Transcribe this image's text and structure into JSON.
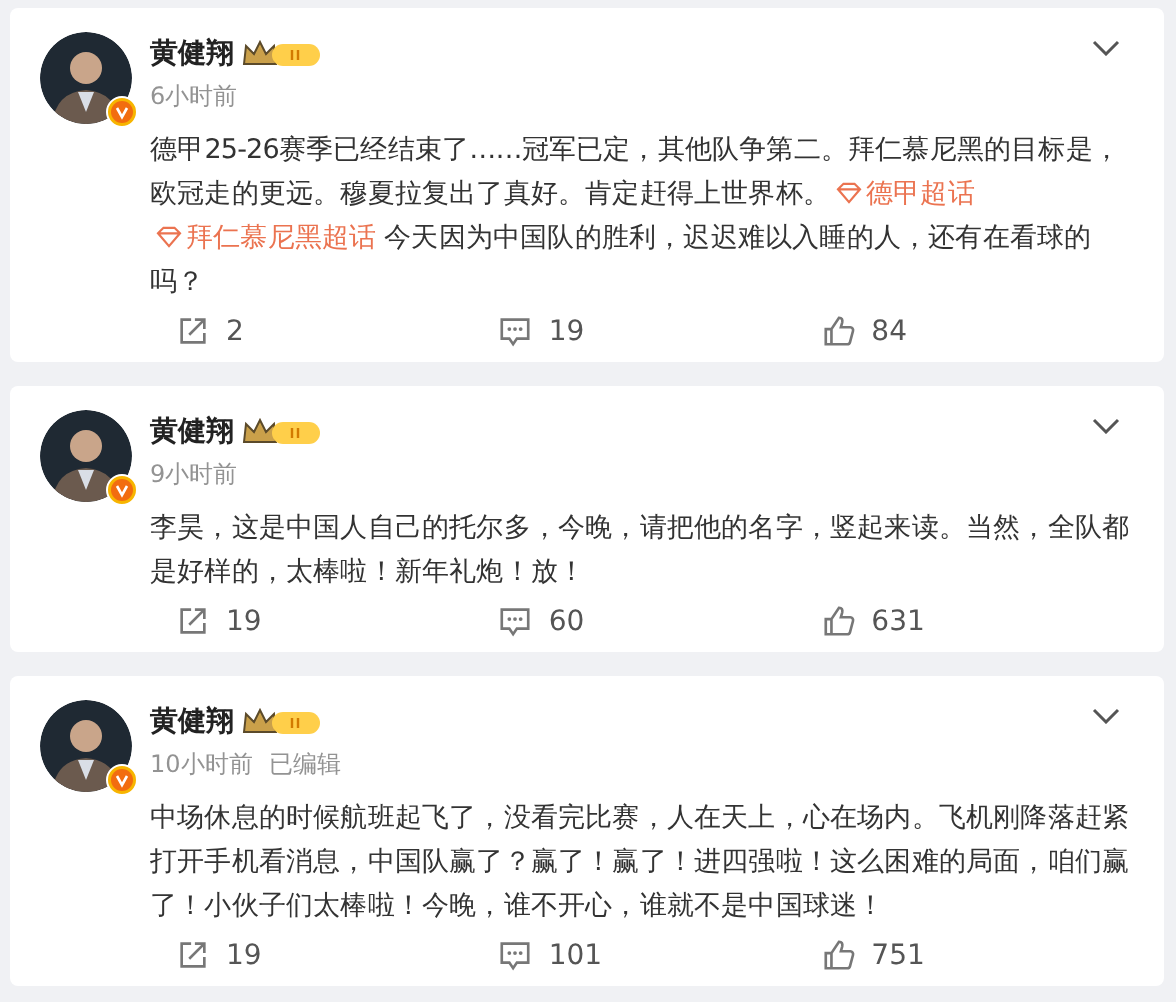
{
  "posts": [
    {
      "author": "黄健翔",
      "time": "6小时前",
      "content": [
        {
          "kind": "text",
          "text": "德甲25-26赛季已经结束了……冠军已定，其他队争第二。拜仁慕尼黑的目标是，欧冠走的更远。穆夏拉复出了真好。肯定赶得上世界杯。"
        },
        {
          "kind": "topic",
          "text": "德甲超话"
        },
        {
          "kind": "topic",
          "text": "拜仁慕尼黑超话"
        },
        {
          "kind": "text",
          "text": " 今天因为中国队的胜利，迟迟难以入睡的人，还有在看球的吗？"
        }
      ],
      "shares": "2",
      "comments": "19",
      "likes": "84"
    },
    {
      "author": "黄健翔",
      "time": "9小时前",
      "content": [
        {
          "kind": "text",
          "text": "李昊，这是中国人自己的托尔多，今晚，请把他的名字，竖起来读。当然，全队都是好样的，太棒啦！新年礼炮！放！"
        }
      ],
      "shares": "19",
      "comments": "60",
      "likes": "631"
    },
    {
      "author": "黄健翔",
      "time": "10小时前",
      "edited": "已编辑",
      "content": [
        {
          "kind": "text",
          "text": "中场休息的时候航班起飞了，没看完比赛，人在天上，心在场内。飞机刚降落赶紧打开手机看消息，中国队赢了？赢了！赢了！进四强啦！这么困难的局面，咱们赢了！小伙子们太棒啦！今晚，谁不开心，谁就不是中国球迷！"
        }
      ],
      "shares": "19",
      "comments": "101",
      "likes": "751"
    }
  ]
}
